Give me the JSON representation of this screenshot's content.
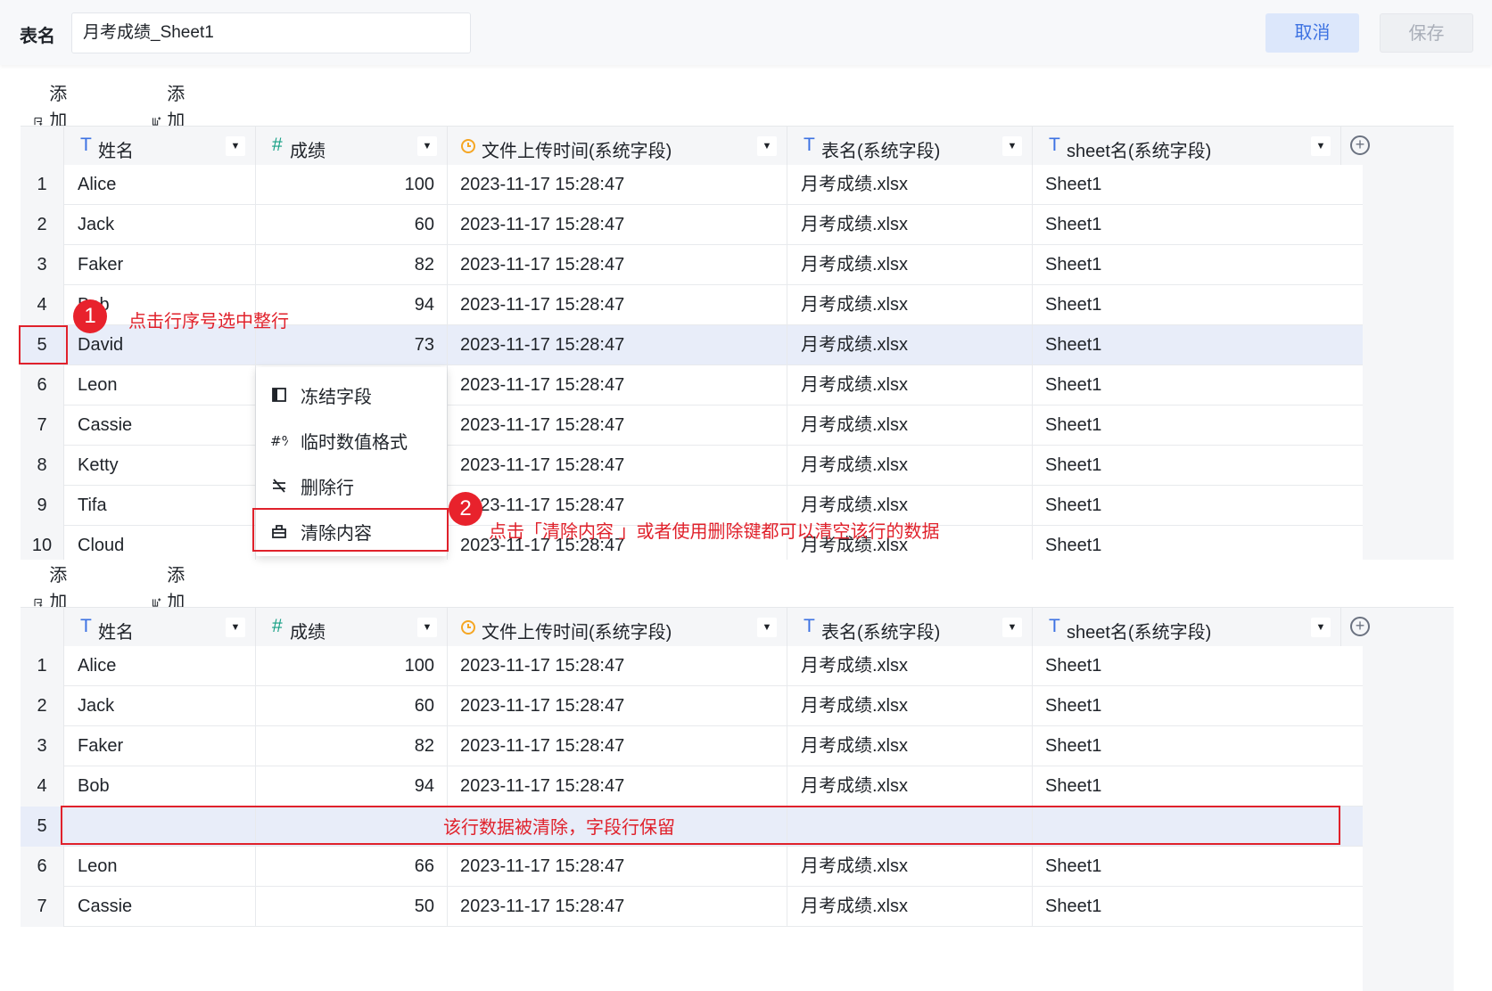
{
  "header": {
    "table_name_label": "表名",
    "table_name_value": "月考成绩_Sheet1",
    "cancel_label": "取消",
    "save_label": "保存"
  },
  "toolbar": {
    "add_row_label": "添加行",
    "add_col_label": "添加列"
  },
  "columns": [
    {
      "type_icon": "T",
      "label": "姓名"
    },
    {
      "type_icon": "#",
      "label": "成绩"
    },
    {
      "type_icon": "clock",
      "label": "文件上传时间(系统字段)"
    },
    {
      "type_icon": "T",
      "label": "表名(系统字段)"
    },
    {
      "type_icon": "T",
      "label": "sheet名(系统字段)"
    }
  ],
  "grid_top": {
    "rows": [
      {
        "index": "1",
        "name": "Alice",
        "score": "100",
        "time": "2023-11-17 15:28:47",
        "file": "月考成绩.xlsx",
        "sheet": "Sheet1"
      },
      {
        "index": "2",
        "name": "Jack",
        "score": "60",
        "time": "2023-11-17 15:28:47",
        "file": "月考成绩.xlsx",
        "sheet": "Sheet1"
      },
      {
        "index": "3",
        "name": "Faker",
        "score": "82",
        "time": "2023-11-17 15:28:47",
        "file": "月考成绩.xlsx",
        "sheet": "Sheet1"
      },
      {
        "index": "4",
        "name": "Bob",
        "score": "94",
        "time": "2023-11-17 15:28:47",
        "file": "月考成绩.xlsx",
        "sheet": "Sheet1"
      },
      {
        "index": "5",
        "name": "David",
        "score": "73",
        "time": "2023-11-17 15:28:47",
        "file": "月考成绩.xlsx",
        "sheet": "Sheet1"
      },
      {
        "index": "6",
        "name": "Leon",
        "score": "",
        "time": "2023-11-17 15:28:47",
        "file": "月考成绩.xlsx",
        "sheet": "Sheet1"
      },
      {
        "index": "7",
        "name": "Cassie",
        "score": "",
        "time": "2023-11-17 15:28:47",
        "file": "月考成绩.xlsx",
        "sheet": "Sheet1"
      },
      {
        "index": "8",
        "name": "Ketty",
        "score": "",
        "time": "2023-11-17 15:28:47",
        "file": "月考成绩.xlsx",
        "sheet": "Sheet1"
      },
      {
        "index": "9",
        "name": "Tifa",
        "score": "",
        "time": "2023-11-17 15:28:47",
        "file": "月考成绩.xlsx",
        "sheet": "Sheet1"
      },
      {
        "index": "10",
        "name": "Cloud",
        "score": "",
        "time": "2023-11-17 15:28:47",
        "file": "月考成绩.xlsx",
        "sheet": "Sheet1"
      }
    ],
    "selected_row": "5"
  },
  "grid_bottom": {
    "rows": [
      {
        "index": "1",
        "name": "Alice",
        "score": "100",
        "time": "2023-11-17 15:28:47",
        "file": "月考成绩.xlsx",
        "sheet": "Sheet1"
      },
      {
        "index": "2",
        "name": "Jack",
        "score": "60",
        "time": "2023-11-17 15:28:47",
        "file": "月考成绩.xlsx",
        "sheet": "Sheet1"
      },
      {
        "index": "3",
        "name": "Faker",
        "score": "82",
        "time": "2023-11-17 15:28:47",
        "file": "月考成绩.xlsx",
        "sheet": "Sheet1"
      },
      {
        "index": "4",
        "name": "Bob",
        "score": "94",
        "time": "2023-11-17 15:28:47",
        "file": "月考成绩.xlsx",
        "sheet": "Sheet1"
      },
      {
        "index": "5",
        "name": "",
        "score": "",
        "time": "",
        "file": "",
        "sheet": ""
      },
      {
        "index": "6",
        "name": "Leon",
        "score": "66",
        "time": "2023-11-17 15:28:47",
        "file": "月考成绩.xlsx",
        "sheet": "Sheet1"
      },
      {
        "index": "7",
        "name": "Cassie",
        "score": "50",
        "time": "2023-11-17 15:28:47",
        "file": "月考成绩.xlsx",
        "sheet": "Sheet1"
      }
    ],
    "selected_row": "5"
  },
  "context_menu": {
    "items": [
      {
        "icon": "freeze-icon",
        "label": "冻结字段"
      },
      {
        "icon": "number-format-icon",
        "label": "临时数值格式"
      },
      {
        "icon": "delete-row-icon",
        "label": "删除行"
      },
      {
        "icon": "clear-content-icon",
        "label": "清除内容"
      }
    ]
  },
  "annotations": {
    "step1_number": "1",
    "step1_text": "点击行序号选中整行",
    "step2_number": "2",
    "step2_text": "点击「清除内容 」或者使用删除键都可以清空该行的数据",
    "step3_text": "该行数据被清除，字段行保留"
  },
  "colors": {
    "accent": "#3d72e2",
    "selected_row": "#e8edf9",
    "annotation_red": "#e0212b",
    "header_bg": "#f5f6f8"
  }
}
